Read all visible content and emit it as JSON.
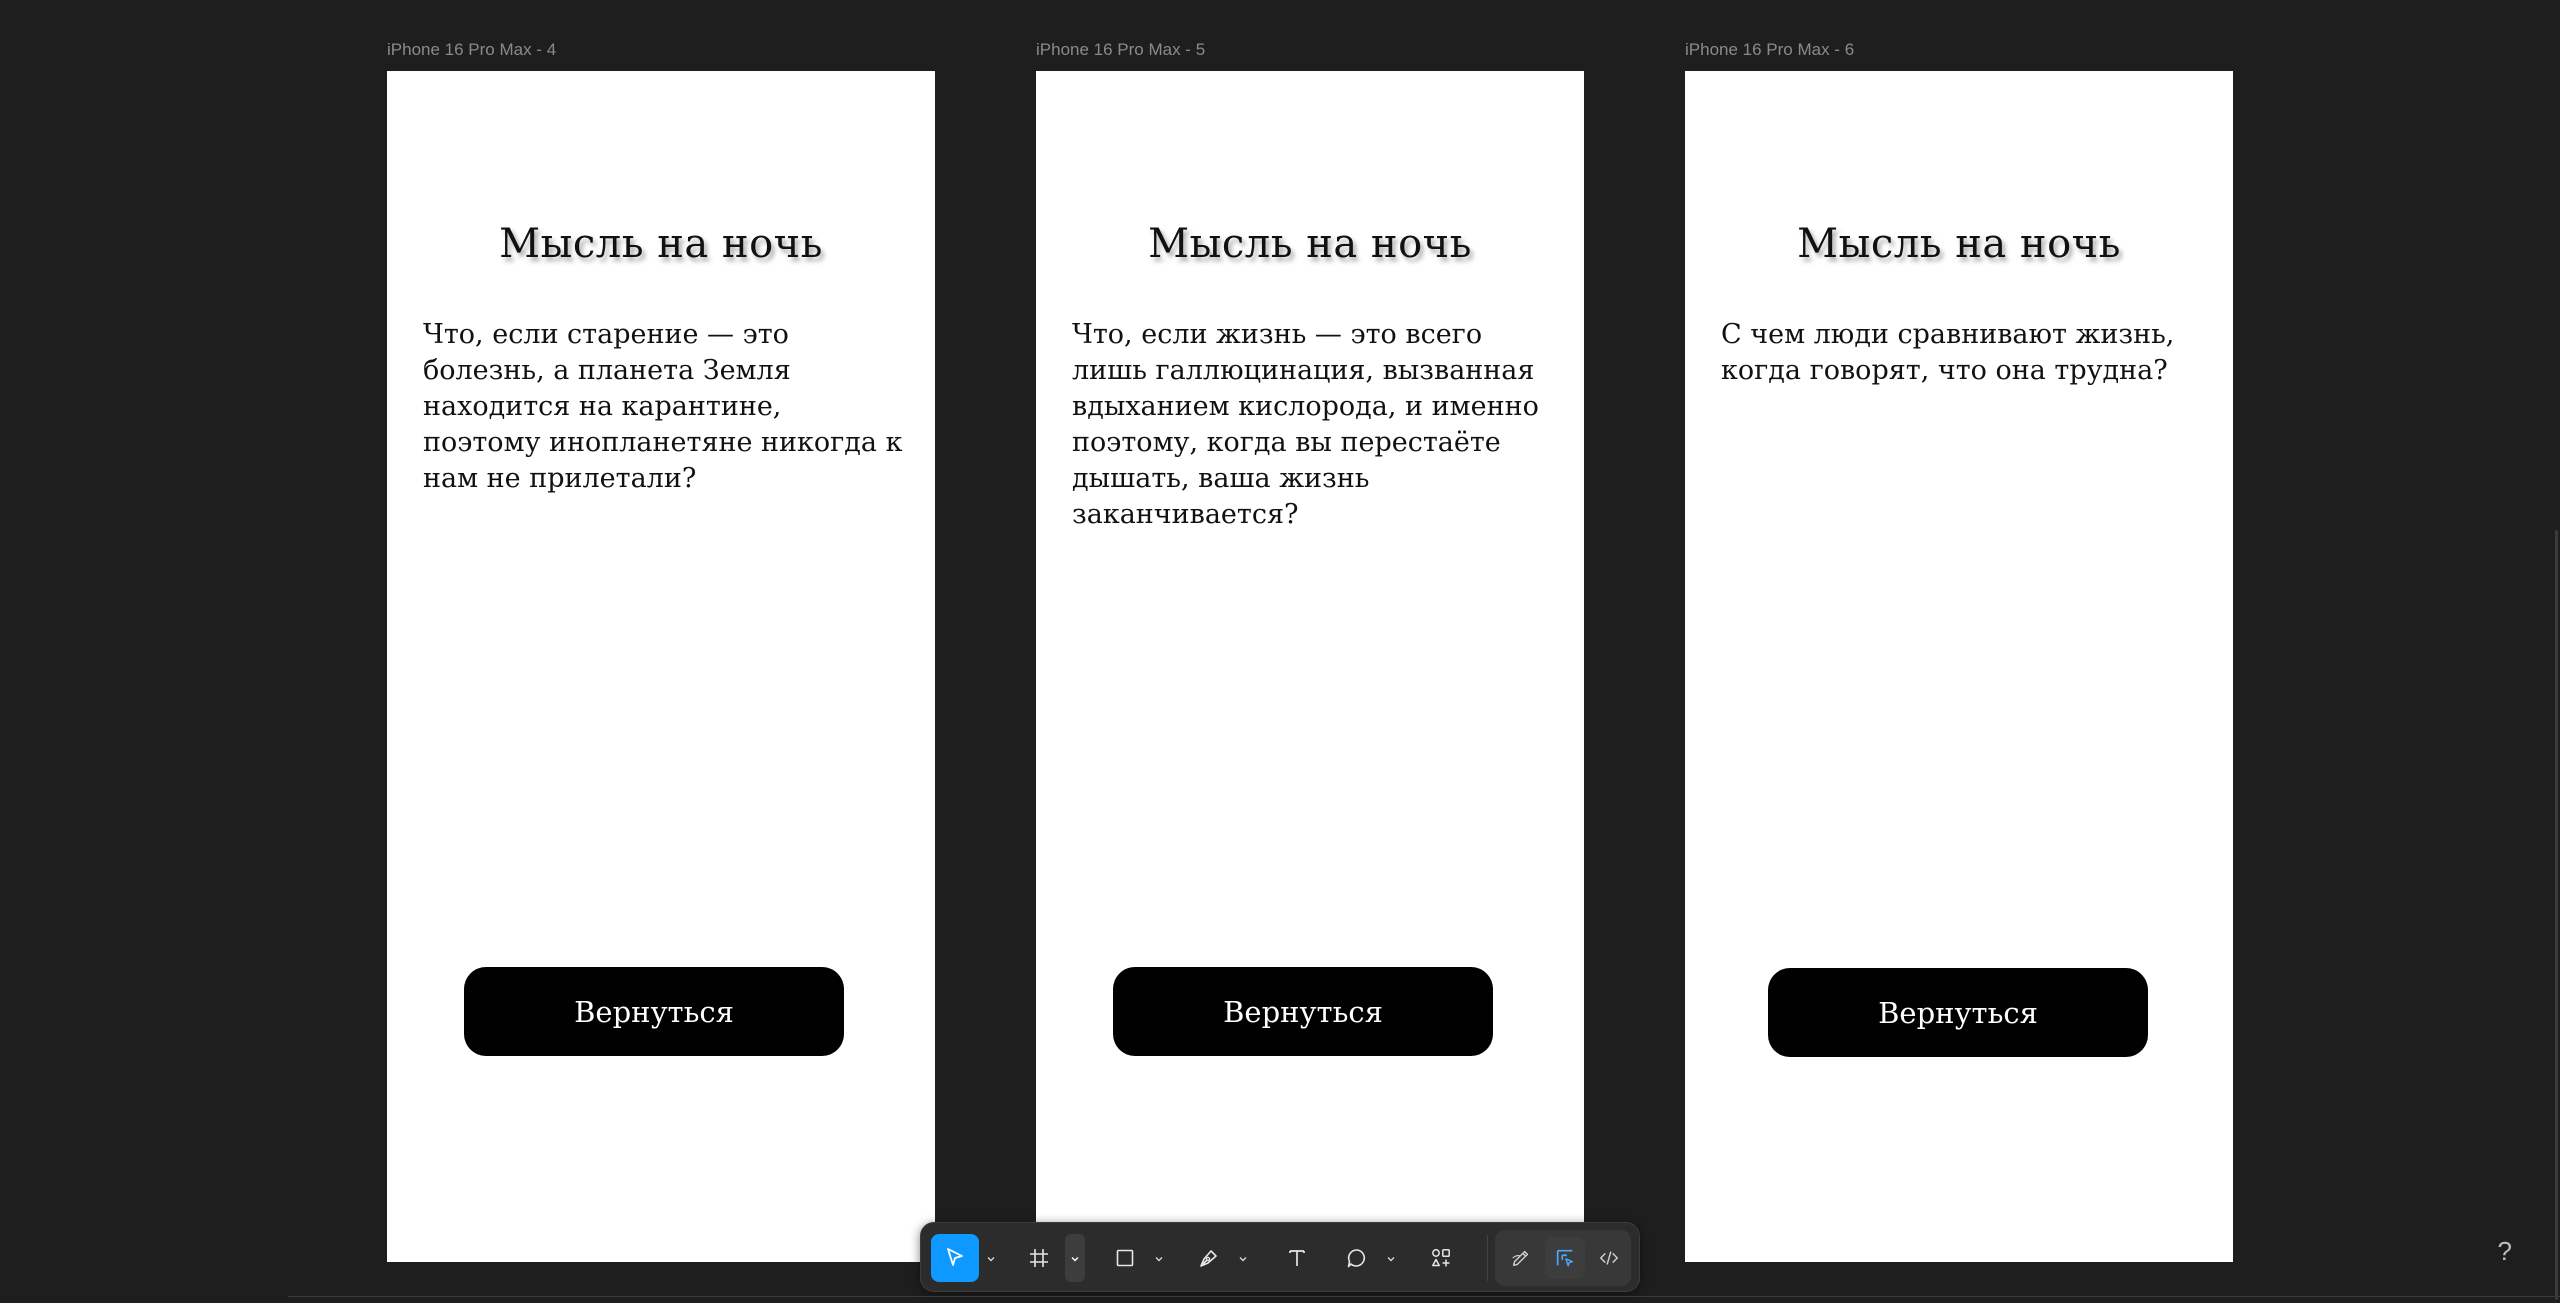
{
  "frames": [
    {
      "label": "iPhone 16 Pro Max - 4",
      "title": "Мысль на ночь",
      "text": "Что, если старение — это болезнь, а планета Земля находится на карантине, поэтому инопланетяне никогда к нам не прилетали?",
      "button": "Вернуться"
    },
    {
      "label": "iPhone 16 Pro Max - 5",
      "title": "Мысль на ночь",
      "text": "Что, если жизнь — это всего лишь галлюцинация, вызванная вдыханием кислорода, и именно поэтому, когда вы перестаёте дышать, ваша жизнь заканчивается?",
      "button": "Вернуться"
    },
    {
      "label": "iPhone 16 Pro Max - 6",
      "title": "Мысль на ночь",
      "text": "С чем люди сравнивают жизнь, когда говорят, что она трудна?",
      "button": "Вернуться"
    }
  ],
  "toolbar": {
    "tools": [
      "move-icon",
      "frame-icon",
      "rectangle-icon",
      "pen-icon",
      "text-icon",
      "comment-icon",
      "actions-icon",
      "draw-mode-icon",
      "design-mode-icon",
      "dev-mode-icon"
    ],
    "active_tool": "move-icon",
    "accent_color": "#0d99ff"
  },
  "help_label": "?"
}
